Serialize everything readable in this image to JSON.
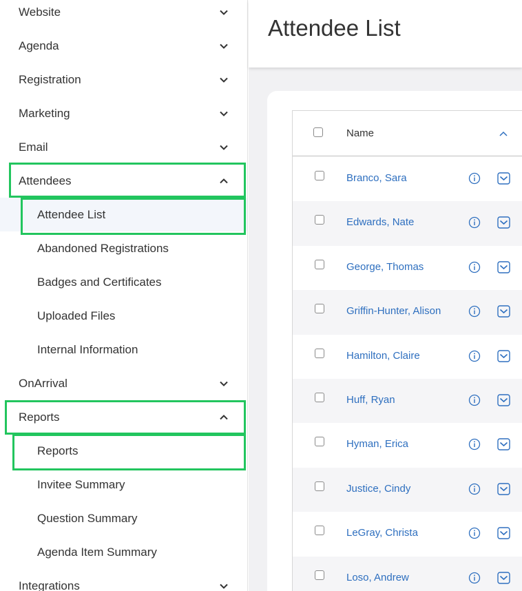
{
  "sidebar": {
    "items": [
      {
        "label": "Website",
        "level": 0,
        "expanded": false
      },
      {
        "label": "Agenda",
        "level": 0,
        "expanded": false
      },
      {
        "label": "Registration",
        "level": 0,
        "expanded": false
      },
      {
        "label": "Marketing",
        "level": 0,
        "expanded": false
      },
      {
        "label": "Email",
        "level": 0,
        "expanded": false
      },
      {
        "label": "Attendees",
        "level": 0,
        "expanded": true
      },
      {
        "label": "Attendee List",
        "level": 1,
        "active": true
      },
      {
        "label": "Abandoned Registrations",
        "level": 1
      },
      {
        "label": "Badges and Certificates",
        "level": 1
      },
      {
        "label": "Uploaded Files",
        "level": 1
      },
      {
        "label": "Internal Information",
        "level": 1
      },
      {
        "label": "OnArrival",
        "level": 0,
        "expanded": false
      },
      {
        "label": "Reports",
        "level": 0,
        "expanded": true
      },
      {
        "label": "Reports",
        "level": 1
      },
      {
        "label": "Invitee Summary",
        "level": 1
      },
      {
        "label": "Question Summary",
        "level": 1
      },
      {
        "label": "Agenda Item Summary",
        "level": 1
      },
      {
        "label": "Integrations",
        "level": 0,
        "expanded": false
      }
    ]
  },
  "header": {
    "title": "Attendee List"
  },
  "table": {
    "columns": [
      "Name"
    ],
    "rows": [
      {
        "name": "Branco, Sara"
      },
      {
        "name": "Edwards, Nate"
      },
      {
        "name": "George, Thomas"
      },
      {
        "name": "Griffin-Hunter, Alison"
      },
      {
        "name": "Hamilton, Claire"
      },
      {
        "name": "Huff, Ryan"
      },
      {
        "name": "Hyman, Erica"
      },
      {
        "name": "Justice, Cindy"
      },
      {
        "name": "LeGray, Christa"
      },
      {
        "name": "Loso, Andrew"
      }
    ]
  },
  "colors": {
    "link": "#2e6fbf",
    "highlight": "#22c55e",
    "icon": "#2e6fbf"
  },
  "icons": {
    "expand": "chevron-down-icon",
    "collapse": "chevron-up-icon",
    "sort": "sort-ascending-icon",
    "info": "info-icon",
    "row_action": "mail-dropdown-icon"
  }
}
